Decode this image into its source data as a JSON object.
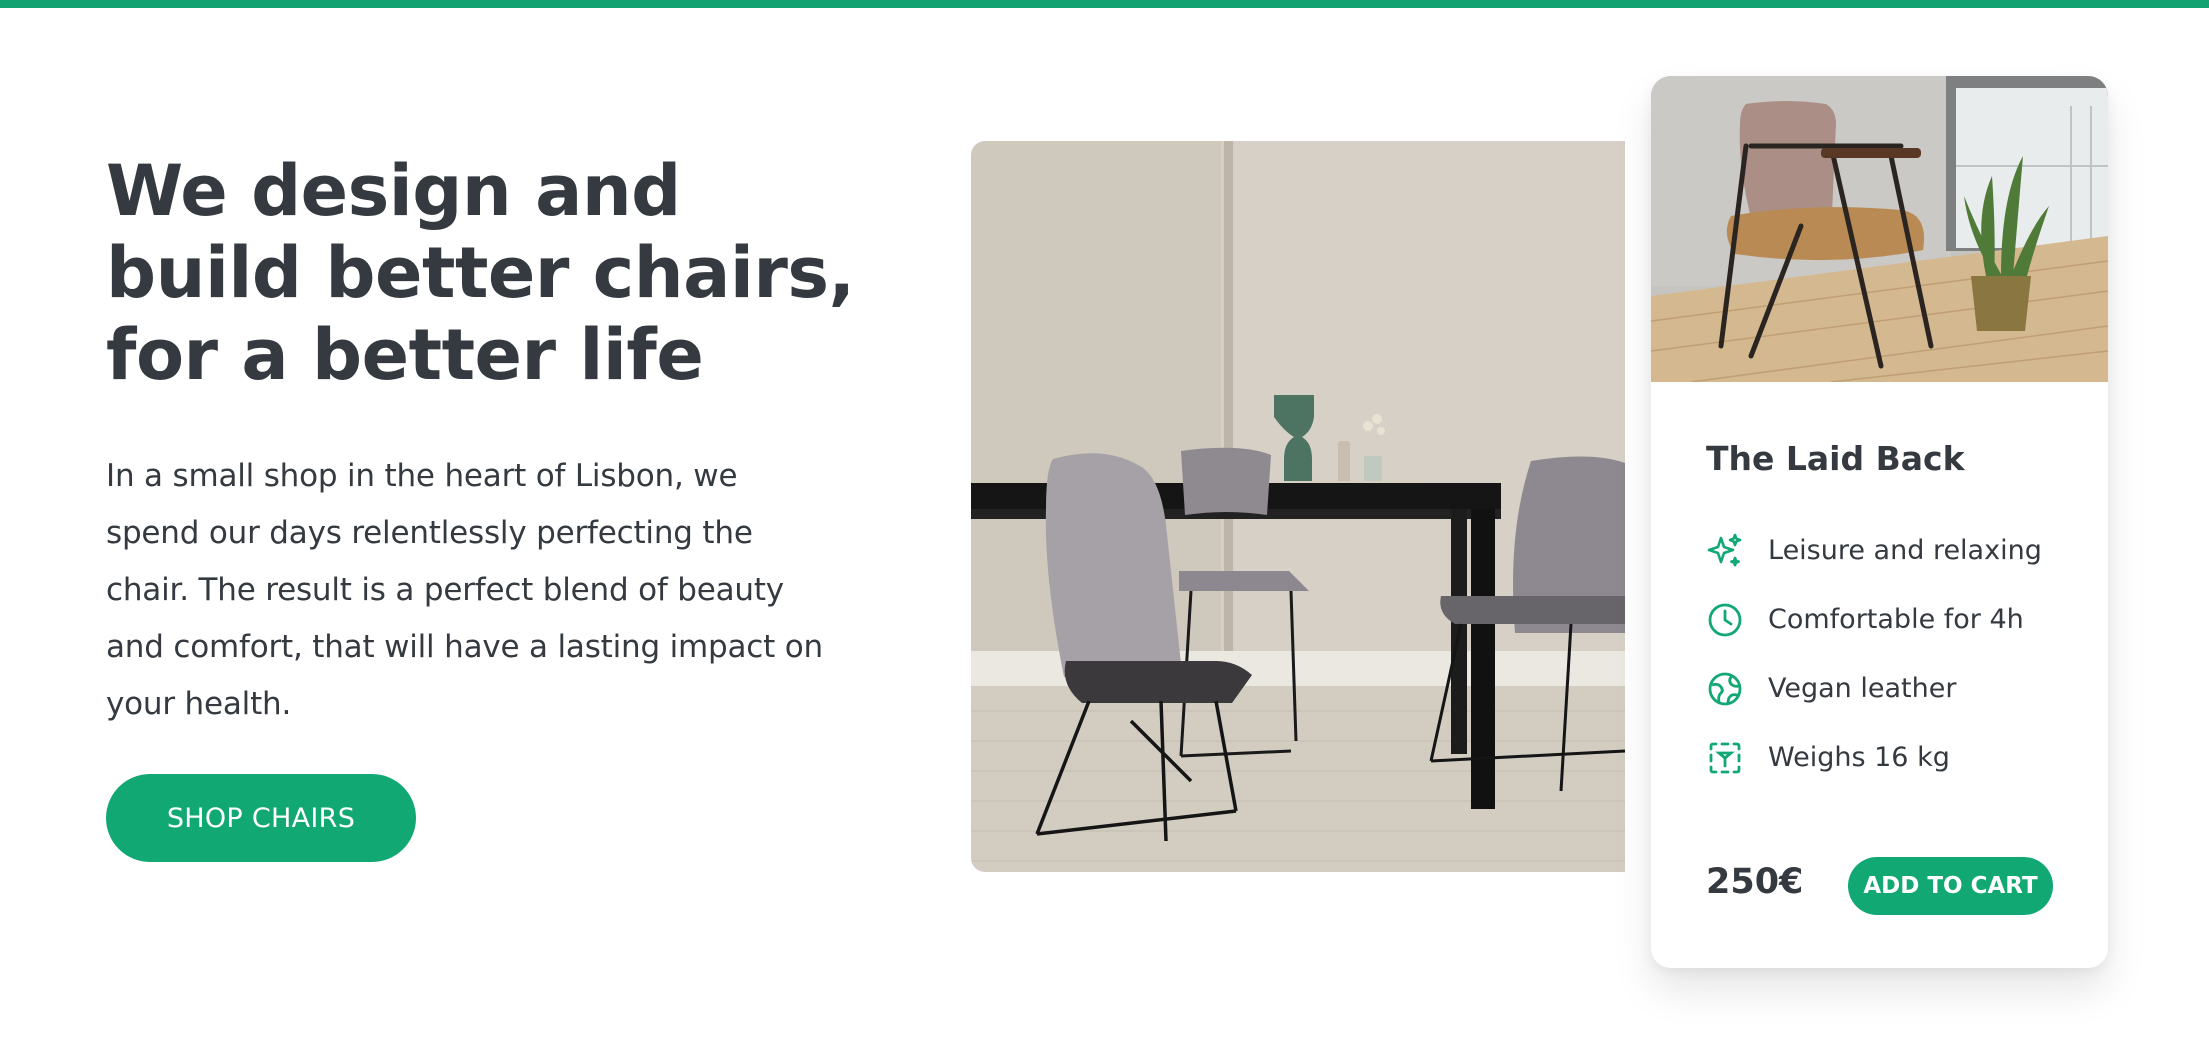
{
  "hero": {
    "headline_lines": [
      "We design and",
      "build better chairs,",
      "for a better life"
    ],
    "description_lines": [
      "In a small shop in the heart of Lisbon, we",
      "spend our days relentlessly perfecting the",
      "chair. The result is a perfect blend of beauty",
      "and comfort, that will have a lasting impact on",
      "your health."
    ],
    "cta_label": "SHOP CHAIRS"
  },
  "product": {
    "name": "The Laid Back",
    "features": [
      {
        "icon": "sparkles-icon",
        "label": "Leisure and relaxing"
      },
      {
        "icon": "clock-icon",
        "label": "Comfortable for 4h"
      },
      {
        "icon": "globe-icon",
        "label": "Vegan leather"
      },
      {
        "icon": "scale-icon",
        "label": "Weighs 16 kg"
      }
    ],
    "price": "250€",
    "cart_label": "ADD TO CART"
  },
  "colors": {
    "accent": "#12a873",
    "top_bar": "#12a170",
    "text": "#343a40"
  }
}
